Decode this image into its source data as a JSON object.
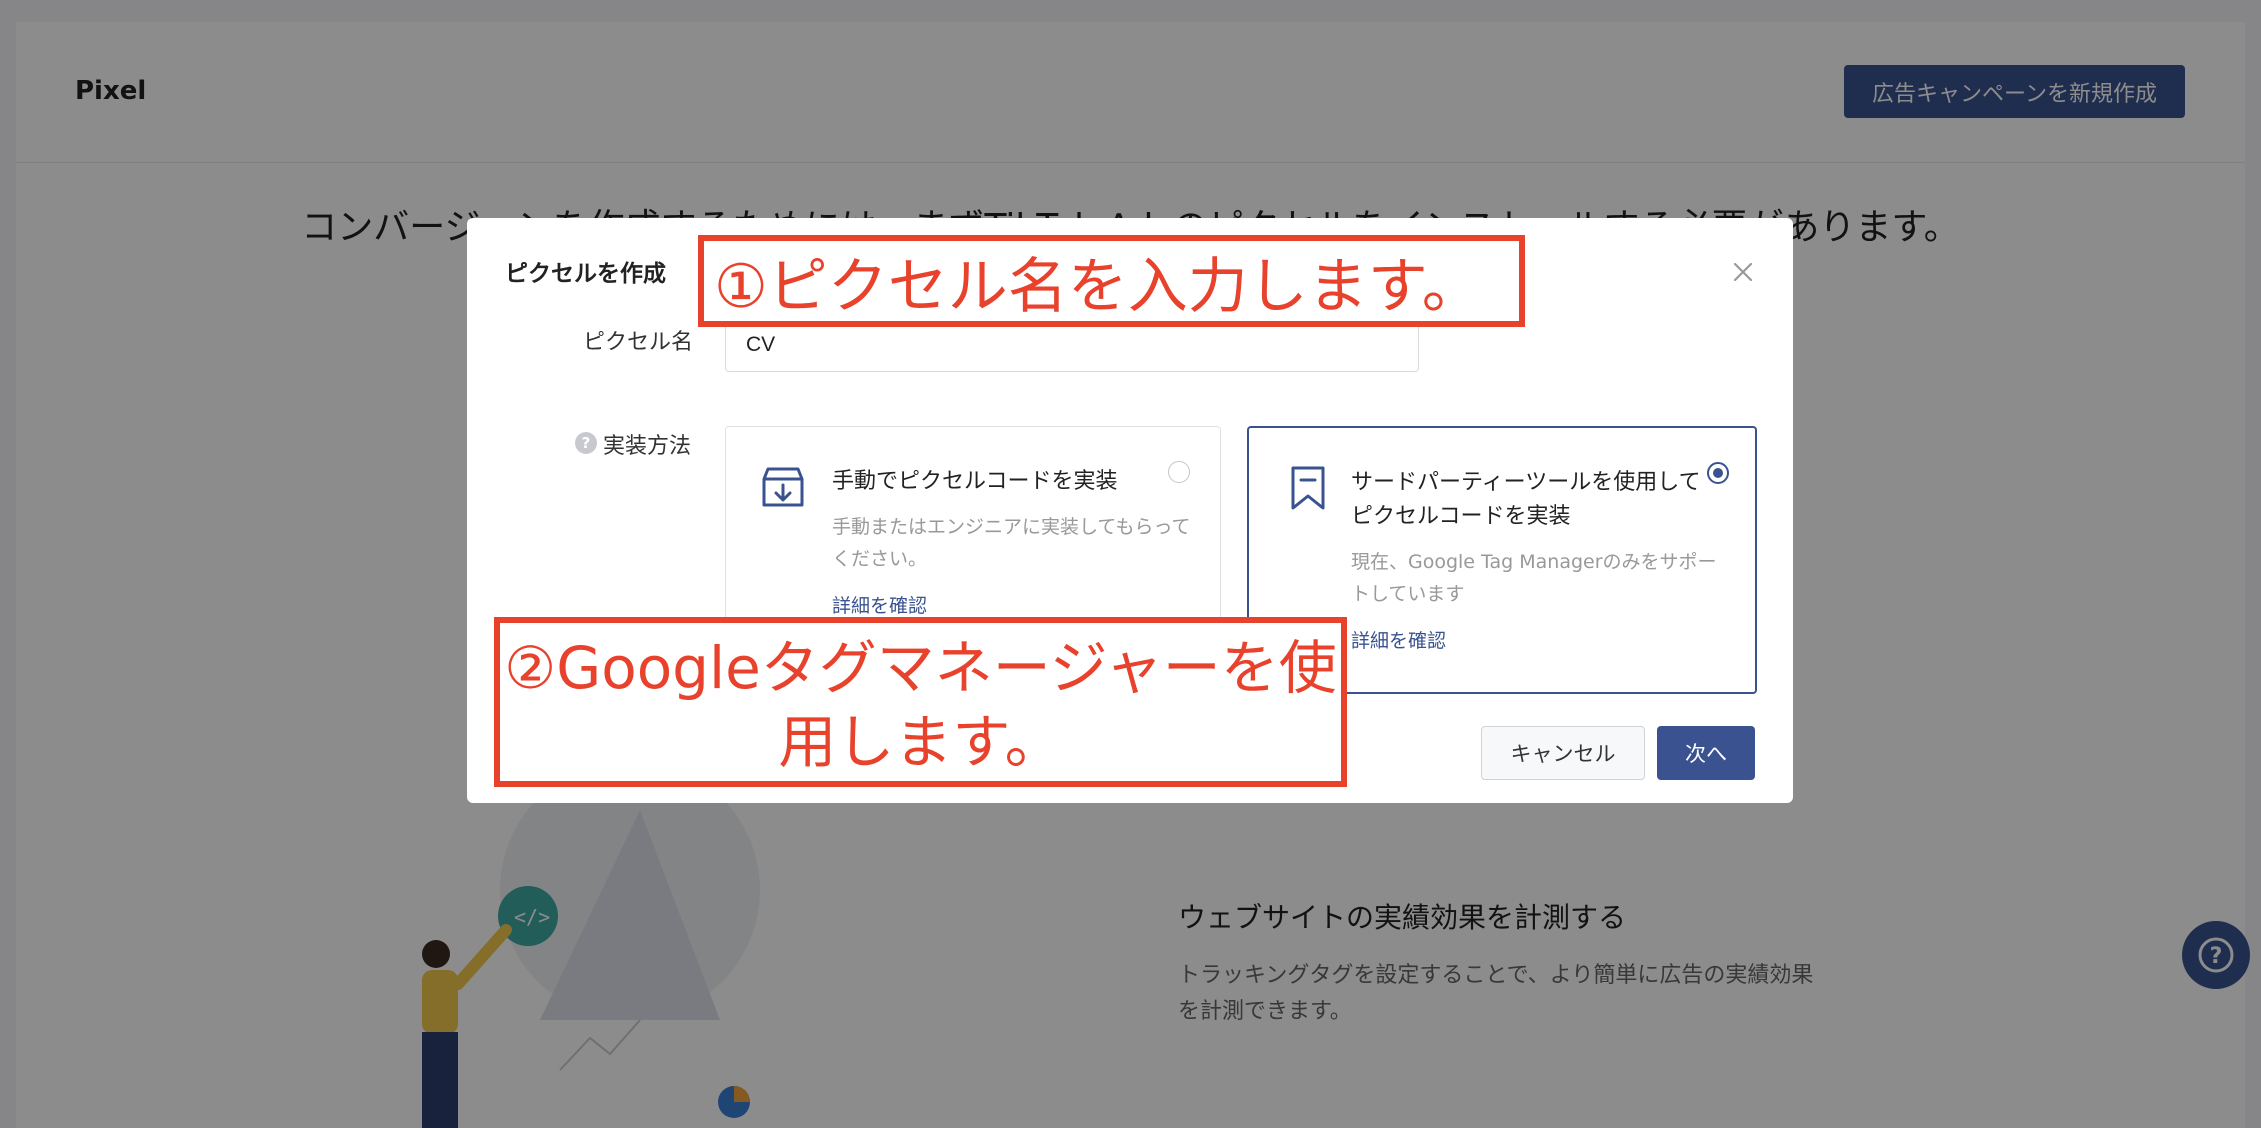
{
  "page": {
    "title": "Pixel",
    "new_campaign_button": "広告キャンペーンを新規作成",
    "intro_text": "コンバージョンを作成するためには、まずTikTok Adsのピクセルをインストールする必要があります。",
    "section_title": "ウェブサイトの実績効果を計測する",
    "section_desc": "トラッキングタグを設定することで、より簡単に広告の実績効果を計測できます。"
  },
  "modal": {
    "title": "ピクセルを作成",
    "pixel_name_label": "ピクセル名",
    "pixel_name_value": "CV",
    "method_label": "実装方法",
    "options": [
      {
        "title": "手動でピクセルコードを実装",
        "desc": "手動またはエンジニアに実装してもらってください。",
        "link": "詳細を確認",
        "icon": "download-box-icon",
        "selected": false
      },
      {
        "title": "サードパーティーツールを使用してピクセルコードを実装",
        "desc": "現在、Google Tag Managerのみをサポートしています",
        "link": "詳細を確認",
        "icon": "bookmark-icon",
        "selected": true
      }
    ],
    "cancel_button": "キャンセル",
    "next_button": "次へ"
  },
  "annotations": {
    "step1": "①ピクセル名を入力します。",
    "step2": "②Googleタグマネージャーを使用します。"
  },
  "colors": {
    "accent": "#3a5390",
    "annotation": "#e8412c",
    "help_dot": "#c7c9ce"
  }
}
